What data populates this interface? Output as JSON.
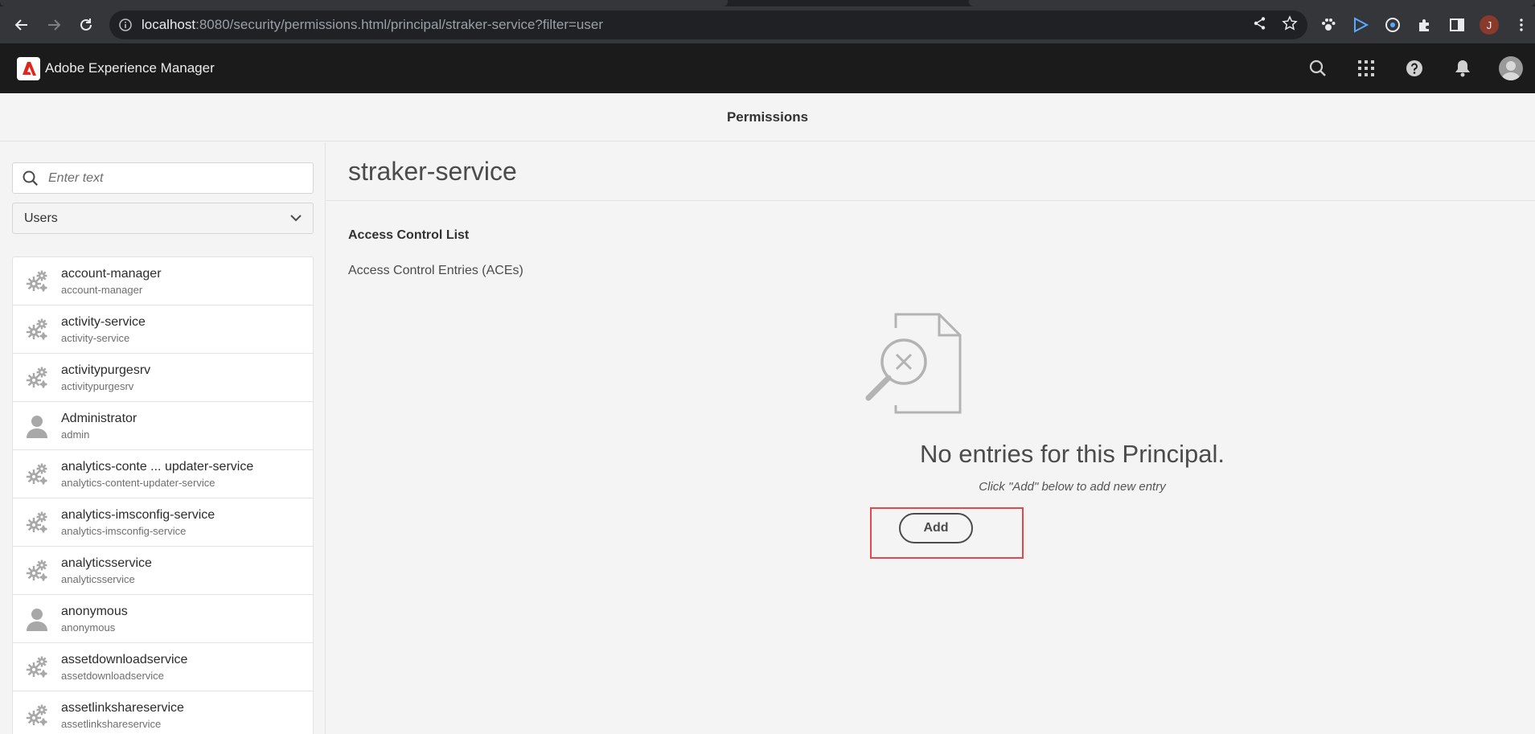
{
  "browser": {
    "url_host": "localhost",
    "url_rest": ":8080/security/permissions.html/principal/straker-service?filter=user",
    "profile_initial": "J"
  },
  "app": {
    "title": "Adobe Experience Manager",
    "page_title": "Permissions"
  },
  "sidebar": {
    "search_placeholder": "Enter text",
    "filter_value": "Users",
    "items": [
      {
        "name": "account-manager",
        "id": "account-manager",
        "icon": "service-gears-icon"
      },
      {
        "name": "activity-service",
        "id": "activity-service",
        "icon": "service-gears-icon"
      },
      {
        "name": "activitypurgesrv",
        "id": "activitypurgesrv",
        "icon": "service-gears-icon"
      },
      {
        "name": "Administrator",
        "id": "admin",
        "icon": "user-icon"
      },
      {
        "name": "analytics-conte ... updater-service",
        "id": "analytics-content-updater-service",
        "icon": "service-gears-icon"
      },
      {
        "name": "analytics-imsconfig-service",
        "id": "analytics-imsconfig-service",
        "icon": "service-gears-icon"
      },
      {
        "name": "analyticsservice",
        "id": "analyticsservice",
        "icon": "service-gears-icon"
      },
      {
        "name": "anonymous",
        "id": "anonymous",
        "icon": "user-icon"
      },
      {
        "name": "assetdownloadservice",
        "id": "assetdownloadservice",
        "icon": "service-gears-icon"
      },
      {
        "name": "assetlinkshareservice",
        "id": "assetlinkshareservice",
        "icon": "service-gears-icon"
      }
    ]
  },
  "main": {
    "principal_name": "straker-service",
    "acl_heading": "Access Control List",
    "aces_heading": "Access Control Entries (ACEs)",
    "empty_title": "No entries for this Principal.",
    "empty_hint": "Click \"Add\" below to add new entry",
    "add_label": "Add"
  },
  "colors": {
    "aem_header": "#1b1b1b",
    "browser_toolbar": "#35363a",
    "highlight": "#e34850",
    "background": "#f4f4f4"
  }
}
